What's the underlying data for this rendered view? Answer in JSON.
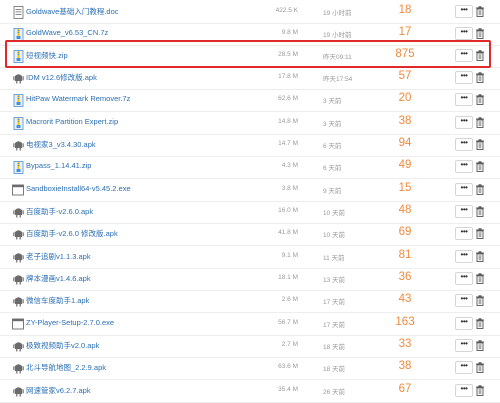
{
  "files": [
    {
      "icon": "doc-icon",
      "name": "Goldwave基础入门教程.doc",
      "size": "422.5 K",
      "time": "19 小时前",
      "count": "18"
    },
    {
      "icon": "zip-icon",
      "name": "GoldWave_v6.53_CN.7z",
      "size": "9.8 M",
      "time": "19 小时前",
      "count": "17"
    },
    {
      "icon": "zip-icon",
      "name": "短视频快.zip",
      "size": "28.5 M",
      "time": "昨天09:11",
      "count": "875"
    },
    {
      "icon": "android-icon",
      "name": "IDM v12.6修改版.apk",
      "size": "17.8 M",
      "time": "昨天17:54",
      "count": "57"
    },
    {
      "icon": "zip-icon",
      "name": "HitPaw Watermark Remover.7z",
      "size": "62.6 M",
      "time": "3 天前",
      "count": "20"
    },
    {
      "icon": "zip-icon",
      "name": "Macrorit Partition Expert.zip",
      "size": "14.8 M",
      "time": "3 天前",
      "count": "38"
    },
    {
      "icon": "android-icon",
      "name": "电视家3_v3.4.30.apk",
      "size": "14.7 M",
      "time": "6 天前",
      "count": "94"
    },
    {
      "icon": "zip-icon",
      "name": "Bypass_1.14.41.zip",
      "size": "4.3 M",
      "time": "6 天前",
      "count": "49"
    },
    {
      "icon": "exe-icon",
      "name": "SandboxieInstall64-v5.45.2.exe",
      "size": "3.8 M",
      "time": "9 天前",
      "count": "15"
    },
    {
      "icon": "android-icon",
      "name": "百度助手-v2.6.0.apk",
      "size": "16.0 M",
      "time": "10 天前",
      "count": "48"
    },
    {
      "icon": "android-icon",
      "name": "百度助手-v2.6.0 修改版.apk",
      "size": "41.8 M",
      "time": "10 天前",
      "count": "69"
    },
    {
      "icon": "android-icon",
      "name": "老子追剧v1.1.3.apk",
      "size": "9.1 M",
      "time": "11 天前",
      "count": "81"
    },
    {
      "icon": "android-icon",
      "name": "牌本漫画v1.4.6.apk",
      "size": "18.1 M",
      "time": "13 天前",
      "count": "36"
    },
    {
      "icon": "android-icon",
      "name": "微信车度助手1.apk",
      "size": "2.6 M",
      "time": "17 天前",
      "count": "43"
    },
    {
      "icon": "exe-icon",
      "name": "ZY-Player-Setup-2.7.0.exe",
      "size": "56.7 M",
      "time": "17 天前",
      "count": "163"
    },
    {
      "icon": "android-icon",
      "name": "极致视频助手v2.0.apk",
      "size": "2.7 M",
      "time": "18 天前",
      "count": "33"
    },
    {
      "icon": "android-icon",
      "name": "北斗导航地图_2.2.9.apk",
      "size": "63.6 M",
      "time": "18 天前",
      "count": "38"
    },
    {
      "icon": "android-icon",
      "name": "网速管家v6.2.7.apk",
      "size": "35.4 M",
      "time": "26 天前",
      "count": "67"
    }
  ],
  "actions": {
    "more_label": "•••",
    "delete_icon": "trash-icon"
  },
  "highlighted_row": 2,
  "colors": {
    "accent": "#f08a3e",
    "link": "#2b6fb3",
    "highlight": "#e02a2a",
    "muted": "#9a9a9a"
  }
}
